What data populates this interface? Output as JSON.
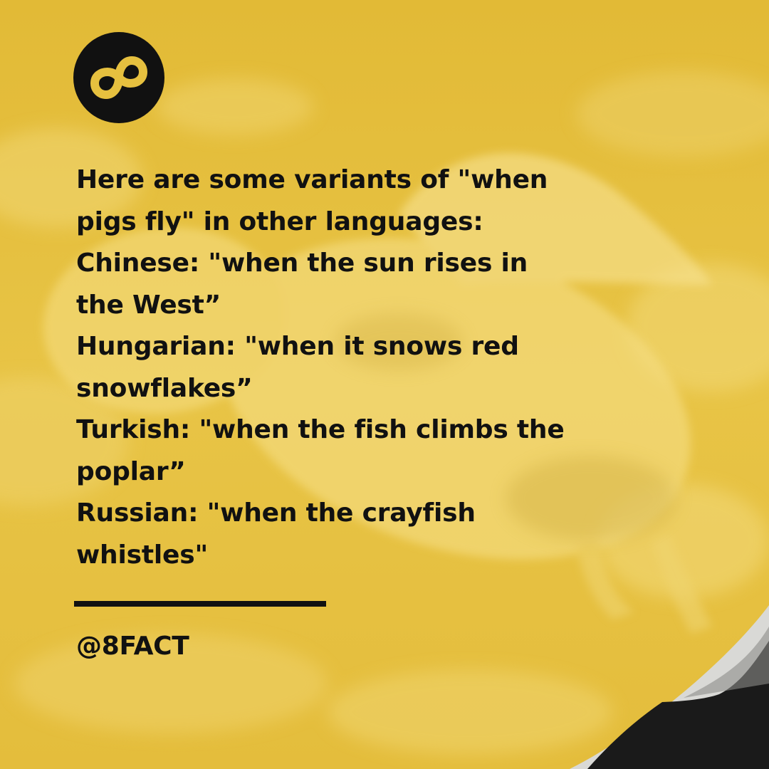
{
  "brand": {
    "logo_icon": "infinity-eight-icon",
    "handle": "@8FACT"
  },
  "fact": {
    "lines": [
      "Here are some variants of \"when",
      "pigs fly\" in other languages:",
      "Chinese: \"when the sun rises in",
      "the West”",
      "Hungarian: \"when it snows red",
      "snowflakes”",
      "Turkish: \"when the fish climbs the",
      "poplar”",
      "Russian: \"when the crayfish",
      "whistles\""
    ]
  },
  "colors": {
    "background": "#e6c03f",
    "text": "#111111",
    "logo_circle": "#111111",
    "logo_symbol": "#e6c03f",
    "corner_dark": "#1a1a1a"
  }
}
